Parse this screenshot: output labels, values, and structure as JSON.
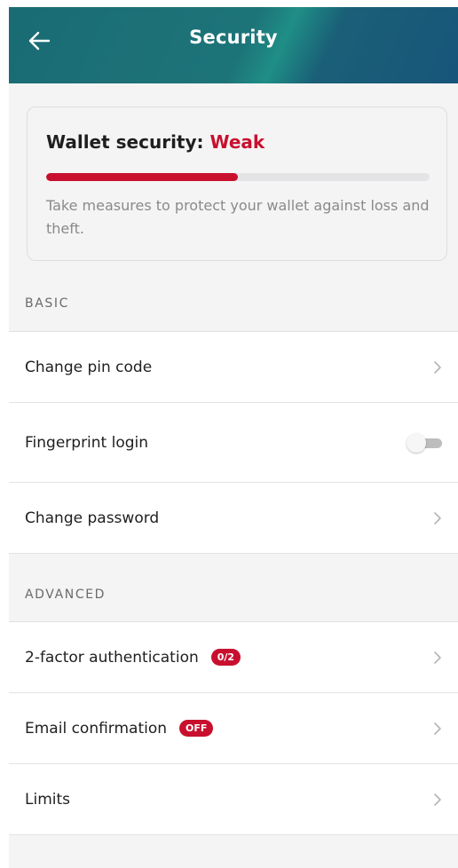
{
  "header": {
    "title": "Security",
    "back_icon": "arrow-left-icon"
  },
  "security_card": {
    "title_prefix": "Wallet security: ",
    "status": "Weak",
    "progress_fraction": 0.5,
    "description": "Take measures to protect your wallet against loss and theft.",
    "colors": {
      "status": "#c8102e",
      "progress_fill": "#c8102e",
      "progress_track": "#e4e4e6"
    }
  },
  "sections": {
    "basic": {
      "label": "BASIC",
      "items": [
        {
          "label": "Change pin code",
          "control": "chevron-right-icon"
        },
        {
          "label": "Fingerprint login",
          "control": "toggle",
          "toggle_on": false
        },
        {
          "label": "Change password",
          "control": "chevron-right-icon"
        }
      ]
    },
    "advanced": {
      "label": "ADVANCED",
      "items": [
        {
          "label": "2-factor authentication",
          "badge": "0/2",
          "control": "chevron-right-icon"
        },
        {
          "label": "Email confirmation",
          "badge": "OFF",
          "control": "chevron-right-icon"
        },
        {
          "label": "Limits",
          "control": "chevron-right-icon"
        }
      ]
    }
  },
  "colors": {
    "header_gradient_start": "#1a6b74",
    "header_gradient_end": "#17557a",
    "accent_red": "#c8102e",
    "background": "#f4f4f4"
  }
}
